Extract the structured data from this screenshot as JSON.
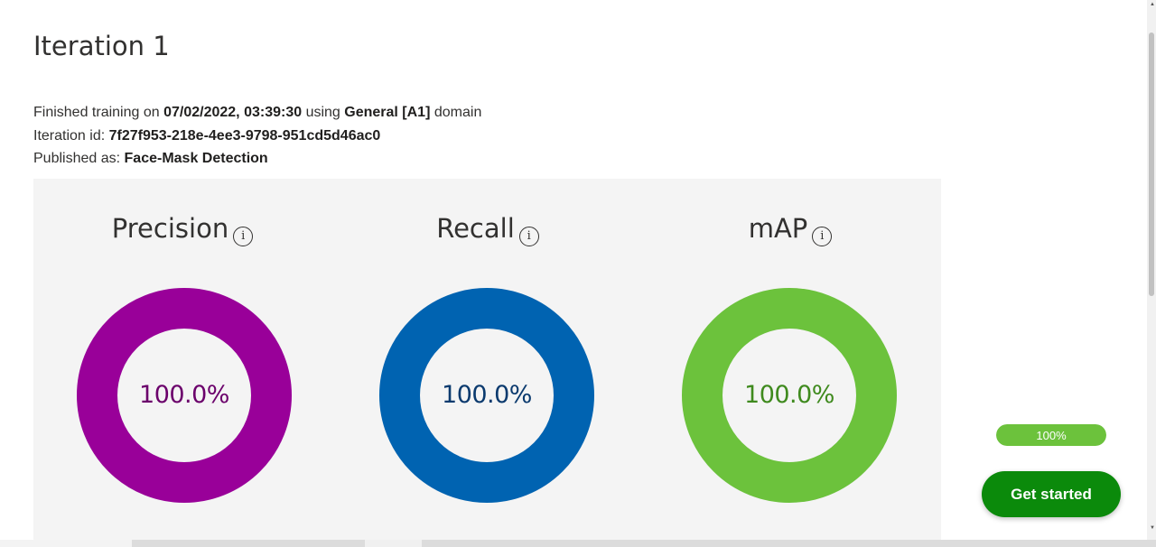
{
  "iteration": {
    "title": "Iteration 1",
    "finished_prefix": "Finished training on",
    "finished_date": "07/02/2022, 03:39:30",
    "using_text": "using",
    "domain_name": "General [A1]",
    "domain_suffix": "domain",
    "id_label": "Iteration id:",
    "id_value": "7f27f953-218e-4ee3-9798-951cd5d46ac0",
    "published_label": "Published as:",
    "published_value": "Face-Mask Detection"
  },
  "metrics": [
    {
      "label": "Precision",
      "value": 1.0,
      "value_text": "100.0%",
      "ring_color": "#990099",
      "text_color": "#6b006b",
      "icon": "info-icon"
    },
    {
      "label": "Recall",
      "value": 1.0,
      "value_text": "100.0%",
      "ring_color": "#0063b1",
      "text_color": "#0b3a6e",
      "icon": "info-icon"
    },
    {
      "label": "mAP",
      "value": 1.0,
      "value_text": "100.0%",
      "ring_color": "#6cc23c",
      "text_color": "#3f8a1e",
      "icon": "info-icon"
    }
  ],
  "info_icon_glyph": "i",
  "progress": {
    "value": 1.0,
    "label": "100%",
    "color": "#6cc23c"
  },
  "get_started": {
    "label": "Get started",
    "color": "#0b8a0b"
  },
  "scroll_arrows": {
    "up": "▲",
    "down": "▼"
  }
}
